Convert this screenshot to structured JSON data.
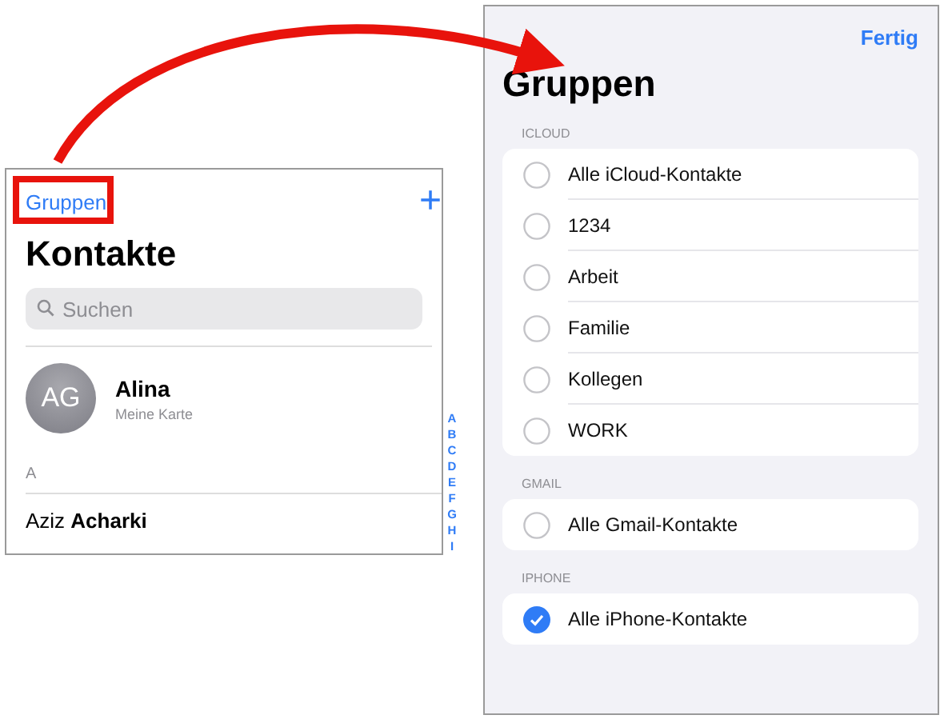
{
  "contacts_screen": {
    "groups_link": "Gruppen",
    "add_button": "+",
    "title": "Kontakte",
    "search": {
      "placeholder": "Suchen"
    },
    "my_card": {
      "initials": "AG",
      "name": "Alina",
      "subtitle": "Meine Karte"
    },
    "section": "A",
    "contacts": [
      "Aziz **Acharki**"
    ],
    "index": [
      "A",
      "B",
      "C",
      "D",
      "E",
      "F",
      "G",
      "H",
      "I"
    ]
  },
  "groups_screen": {
    "done_button": "Fertig",
    "title": "Gruppen",
    "sections": [
      {
        "header": "ICLOUD",
        "groups": [
          {
            "label": "Alle iCloud-Kontakte",
            "selected": false
          },
          {
            "label": "1234",
            "selected": false
          },
          {
            "label": "Arbeit",
            "selected": false
          },
          {
            "label": "Familie",
            "selected": false
          },
          {
            "label": "Kollegen",
            "selected": false
          },
          {
            "label": "WORK",
            "selected": false
          }
        ]
      },
      {
        "header": "GMAIL",
        "groups": [
          {
            "label": "Alle Gmail-Kontakte",
            "selected": false
          }
        ]
      },
      {
        "header": "IPHONE",
        "groups": [
          {
            "label": "Alle iPhone-Kontakte",
            "selected": true
          }
        ]
      }
    ]
  }
}
